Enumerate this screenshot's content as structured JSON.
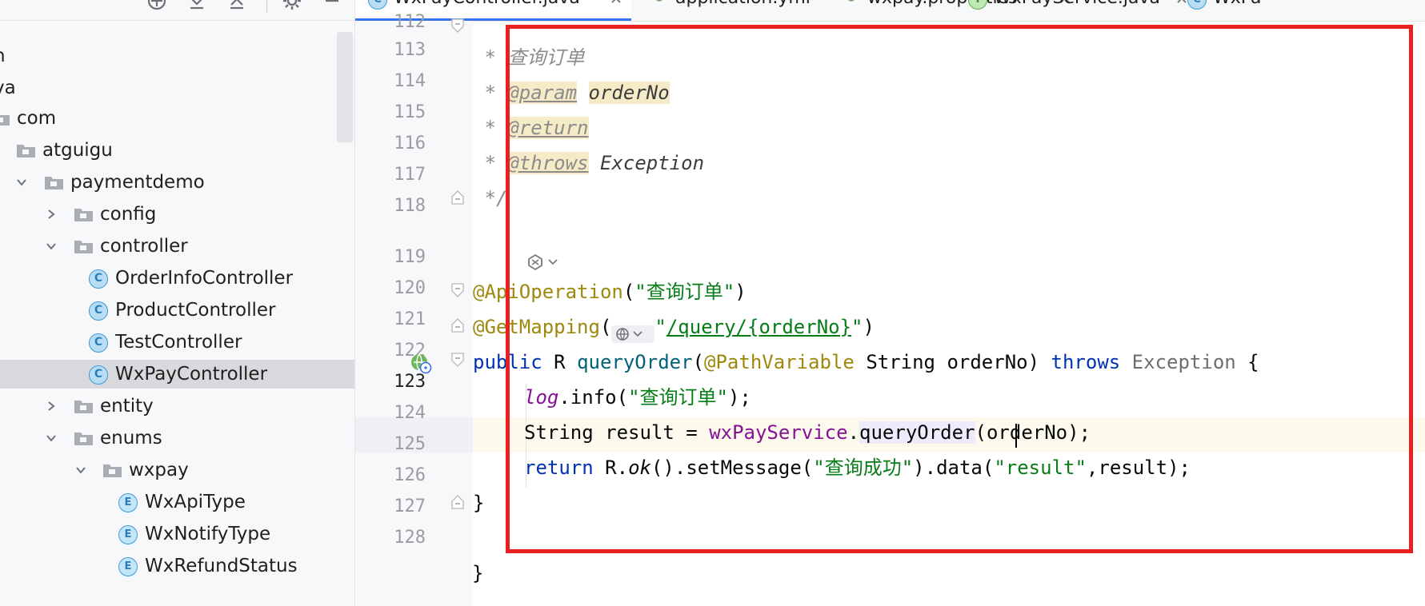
{
  "tree": {
    "items": [
      {
        "label": "n",
        "kind": "text"
      },
      {
        "label": "va",
        "kind": "text"
      },
      {
        "label": "com",
        "kind": "folder"
      },
      {
        "label": "atguigu",
        "kind": "folder"
      },
      {
        "label": "paymentdemo",
        "kind": "folder",
        "expanded": true
      },
      {
        "label": "config",
        "kind": "folder",
        "expanded": false
      },
      {
        "label": "controller",
        "kind": "folder",
        "expanded": true
      },
      {
        "label": "OrderInfoController",
        "kind": "class",
        "icon_letter": "C"
      },
      {
        "label": "ProductController",
        "kind": "class",
        "icon_letter": "C"
      },
      {
        "label": "TestController",
        "kind": "class",
        "icon_letter": "C"
      },
      {
        "label": "WxPayController",
        "kind": "class",
        "icon_letter": "C",
        "selected": true
      },
      {
        "label": "entity",
        "kind": "folder",
        "expanded": false
      },
      {
        "label": "enums",
        "kind": "folder",
        "expanded": true
      },
      {
        "label": "wxpay",
        "kind": "folder",
        "expanded": true
      },
      {
        "label": "WxApiType",
        "kind": "enum",
        "icon_letter": "E"
      },
      {
        "label": "WxNotifyType",
        "kind": "enum",
        "icon_letter": "E"
      },
      {
        "label": "WxRefundStatus",
        "kind": "enum",
        "icon_letter": "E"
      }
    ]
  },
  "tabs": [
    {
      "label": "WxPayController.java",
      "icon": "class-icon",
      "icon_letter": "C",
      "active": true
    },
    {
      "label": "application.yml",
      "icon": "gear-leaf-icon",
      "icon_letter": "⚙",
      "active": false
    },
    {
      "label": "wxpay.properties",
      "icon": "gear-leaf-icon",
      "icon_letter": "⚙",
      "active": false
    },
    {
      "label": "WxPayService.java",
      "icon": "interface-icon",
      "icon_letter": "I",
      "active": false
    },
    {
      "label": "WxPa",
      "icon": "class-icon",
      "icon_letter": "C",
      "active": false
    }
  ],
  "editor": {
    "line_numbers": [
      "112",
      "113",
      "114",
      "115",
      "116",
      "117",
      "118",
      "119",
      "120",
      "121",
      "122",
      "123",
      "124",
      "125",
      "126",
      "127",
      "128"
    ],
    "current_line": "123",
    "code": {
      "l113_text": " * 查询订单",
      "l114_star": " * ",
      "l114_tag": "@param",
      "l114_name": "orderNo",
      "l115_star": " * ",
      "l115_tag": "@return",
      "l116_star": " * ",
      "l116_tag": "@throws",
      "l116_type": "Exception",
      "l117_text": " */",
      "l119_ann": "@ApiOperation",
      "l119_open": "(",
      "l119_str": "\"查询订单\"",
      "l119_close": ")",
      "l120_ann": "@GetMapping",
      "l120_open": "(",
      "l120_q": "\"",
      "l120_path": "/query/{orderNo}",
      "l120_q2": "\"",
      "l120_close": ")",
      "l121_kw": "public",
      "l121_type": "R",
      "l121_fn": "queryOrder",
      "l121_p1": "(",
      "l121_ann": "@PathVariable",
      "l121_param": "String orderNo",
      "l121_p2": ")",
      "l121_throws": "throws",
      "l121_exc": "Exception",
      "l121_brace": "{",
      "l122_log": "log",
      "l122_call": ".info(",
      "l122_str": "\"查询订单\"",
      "l122_end": ");",
      "l123_decl": "String result = ",
      "l123_field": "wxPayService",
      "l123_dot": ".",
      "l123_m1": "query",
      "l123_m2": "Order",
      "l123_args": "(orderNo);",
      "l124_kw": "return",
      "l124_r": "R.",
      "l124_ok": "ok",
      "l124_mid": "().setMessage(",
      "l124_str1": "\"查询成功\"",
      "l124_data": ").data(",
      "l124_str2": "\"result\"",
      "l124_end": ",result);",
      "l125_text": "}",
      "l127_text": "}"
    }
  },
  "colors": {
    "highlight_box": "#ea1f1f",
    "active_tab_underline": "#3574f0",
    "selection": "#d8d9dc"
  }
}
